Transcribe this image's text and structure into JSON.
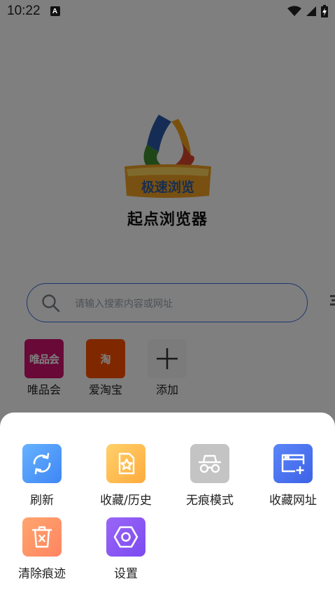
{
  "status_bar": {
    "time": "10:22",
    "notification_glyph": "A"
  },
  "home": {
    "logo_text": "极速浏览",
    "app_title": "起点浏览器",
    "search": {
      "placeholder": "请输入搜索内容或网址"
    },
    "shortcuts": [
      {
        "label": "唯品会",
        "tile_text": "唯品会"
      },
      {
        "label": "爱淘宝",
        "tile_text": "淘"
      },
      {
        "label": "添加"
      }
    ]
  },
  "menu": {
    "items": [
      {
        "label": "刷新",
        "icon": "refresh-icon"
      },
      {
        "label": "收藏/历史",
        "icon": "bookmark-history-icon"
      },
      {
        "label": "无痕模式",
        "icon": "incognito-icon"
      },
      {
        "label": "收藏网址",
        "icon": "add-bookmark-icon"
      },
      {
        "label": "清除痕迹",
        "icon": "clear-trash-icon"
      },
      {
        "label": "设置",
        "icon": "settings-icon"
      }
    ]
  },
  "colors": {
    "accent_blue": "#3a6ee0",
    "vip_pink": "#d0126e",
    "taobao_orange": "#ff5000"
  }
}
